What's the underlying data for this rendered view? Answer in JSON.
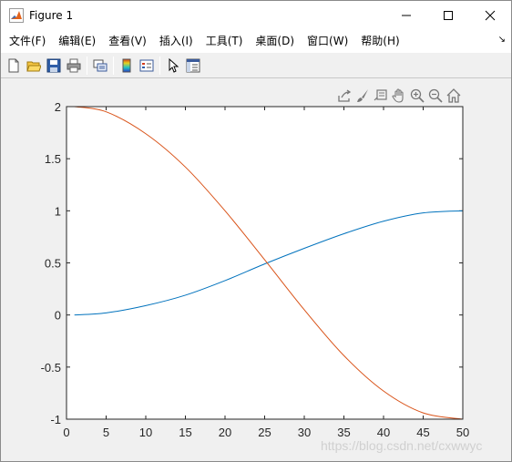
{
  "window": {
    "title": "Figure 1",
    "controls": [
      "minimize-icon",
      "maximize-icon",
      "close-icon"
    ]
  },
  "menubar": {
    "items": [
      {
        "label": "文件(F)"
      },
      {
        "label": "编辑(E)"
      },
      {
        "label": "查看(V)"
      },
      {
        "label": "插入(I)"
      },
      {
        "label": "工具(T)"
      },
      {
        "label": "桌面(D)"
      },
      {
        "label": "窗口(W)"
      },
      {
        "label": "帮助(H)"
      }
    ],
    "overflow_icon": "chevron-icon"
  },
  "toolbar": {
    "icons": [
      "new-figure-icon",
      "open-file-icon",
      "save-icon",
      "print-icon",
      "link-plot-icon",
      "colorbar-icon",
      "legend-icon",
      "edit-plot-arrow-icon",
      "property-inspector-icon"
    ]
  },
  "axes_toolbar": {
    "icons": [
      "export-icon",
      "brush-icon",
      "data-tips-icon",
      "pan-hand-icon",
      "zoom-in-icon",
      "zoom-out-icon",
      "home-icon"
    ]
  },
  "chart_data": {
    "type": "line",
    "xlim": [
      0,
      50
    ],
    "ylim": [
      -1,
      2
    ],
    "xticks": [
      0,
      5,
      10,
      15,
      20,
      25,
      30,
      35,
      40,
      45,
      50
    ],
    "yticks": [
      -1,
      -0.5,
      0,
      0.5,
      1,
      1.5,
      2
    ],
    "xtick_labels": [
      "0",
      "5",
      "10",
      "15",
      "20",
      "25",
      "30",
      "35",
      "40",
      "45",
      "50"
    ],
    "ytick_labels": [
      "-1",
      "-0.5",
      "0",
      "0.5",
      "1",
      "1.5",
      "2"
    ],
    "grid": false,
    "series": [
      {
        "color": "#0072BD",
        "x": [
          1,
          5,
          10,
          15,
          20,
          25,
          30,
          35,
          40,
          45,
          50
        ],
        "y": [
          0.0,
          0.02,
          0.09,
          0.19,
          0.33,
          0.49,
          0.64,
          0.78,
          0.9,
          0.98,
          1.0
        ]
      },
      {
        "color": "#D95319",
        "x": [
          1,
          5,
          10,
          15,
          20,
          25,
          30,
          35,
          40,
          45,
          50
        ],
        "y": [
          2.0,
          1.95,
          1.74,
          1.42,
          1.0,
          0.53,
          0.05,
          -0.39,
          -0.73,
          -0.94,
          -1.0
        ]
      }
    ]
  },
  "watermark": "https://blog.csdn.net/cxwwyc"
}
